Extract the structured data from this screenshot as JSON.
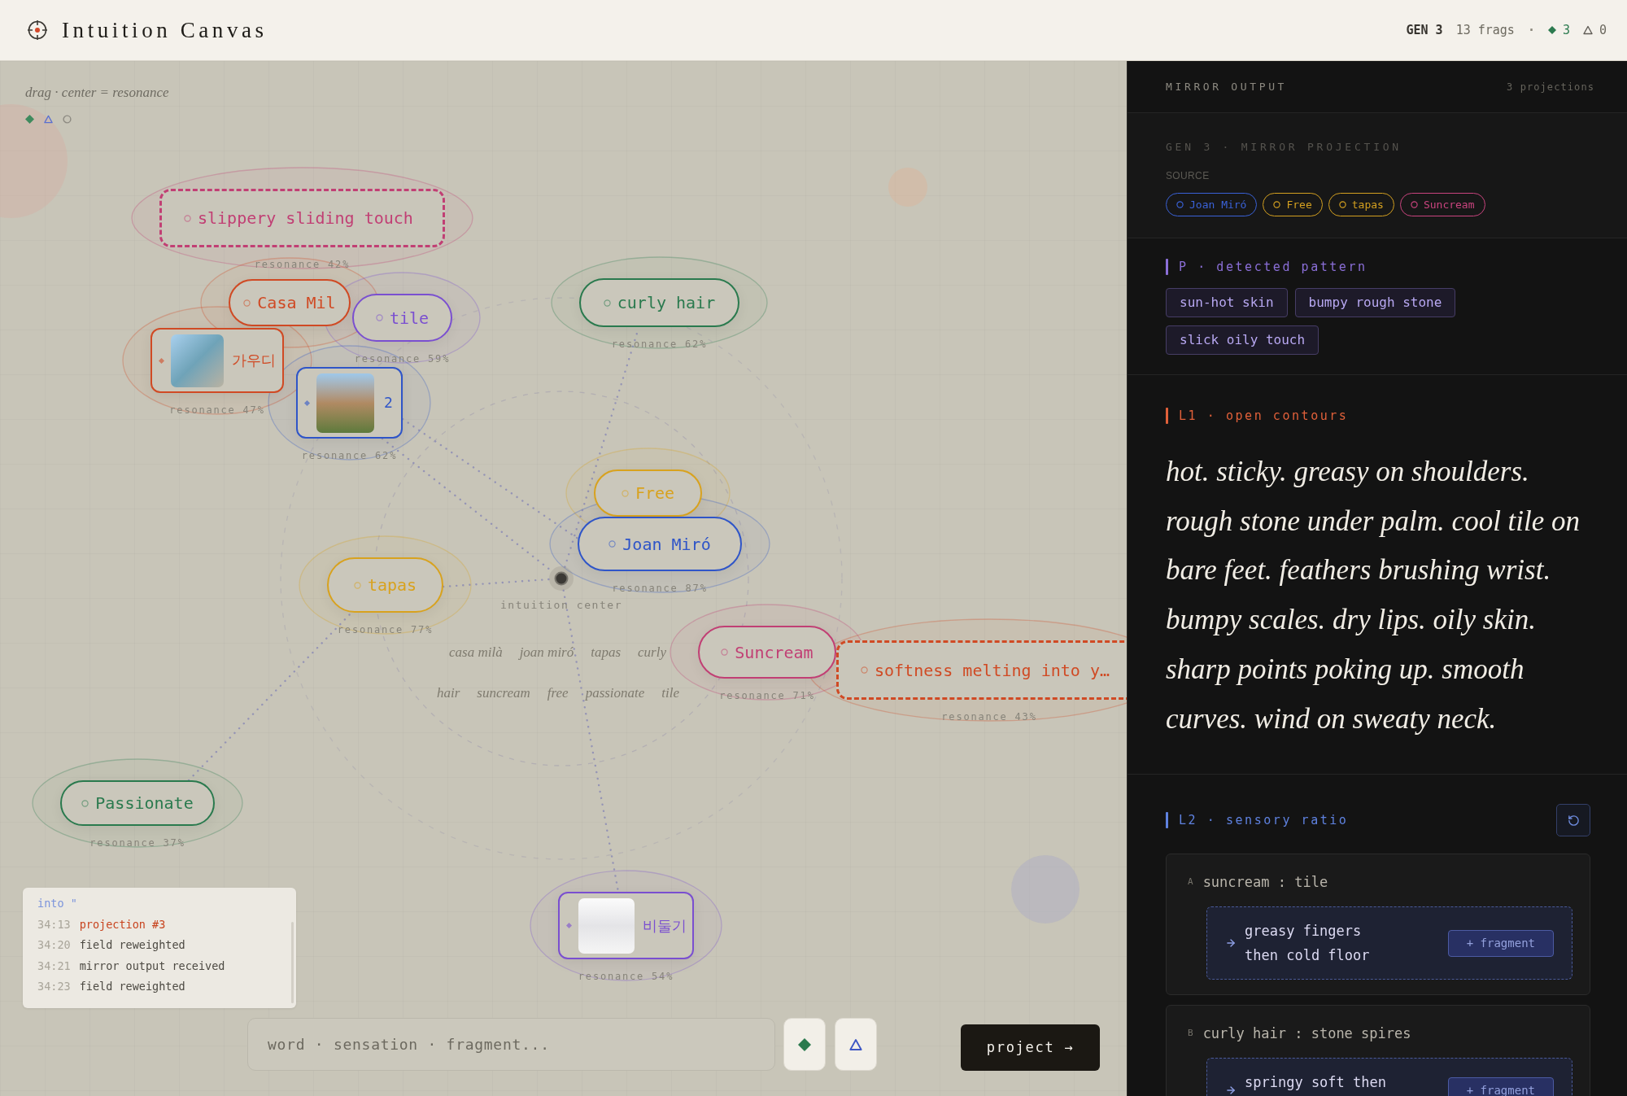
{
  "header": {
    "title": "Intuition Canvas",
    "stats": [
      {
        "kind": "generation",
        "text": "GEN 3"
      },
      {
        "kind": "fragments",
        "text": "13 frags"
      },
      {
        "kind": "separator",
        "text": "·"
      },
      {
        "kind": "kept",
        "text": "3"
      },
      {
        "kind": "flagged",
        "text": "0"
      }
    ]
  },
  "canvas": {
    "hint": "drag · center = resonance",
    "legend": [
      {
        "kind": "diamond",
        "color": "#3f8a5e"
      },
      {
        "kind": "triangle",
        "color": "#5a6fd0"
      },
      {
        "kind": "circle",
        "color": "#8d8a82"
      }
    ],
    "nodes": [
      {
        "kind": "dashed",
        "label": "slippery sliding touch",
        "color": "#c13f74",
        "resonance": "resonance 42%"
      },
      {
        "kind": "pill",
        "label": "Casa Mil",
        "color": "#d04a24"
      },
      {
        "kind": "pill",
        "label": "tile",
        "color": "#7a4fd0",
        "resonance": "resonance 59%"
      },
      {
        "kind": "pill",
        "label": "curly hair",
        "color": "#2a7a4e",
        "resonance": "resonance 62%"
      },
      {
        "kind": "image",
        "label": "가우디",
        "color": "#d04a24",
        "resonance": "resonance 47%"
      },
      {
        "kind": "image",
        "label": "2",
        "color": "#2f55c8",
        "resonance": "resonance 62%"
      },
      {
        "kind": "pill",
        "label": "Free",
        "color": "#d8a21e"
      },
      {
        "kind": "pill",
        "label": "Joan Miró",
        "color": "#2f55c8",
        "resonance": "resonance 87%"
      },
      {
        "kind": "pill",
        "label": "tapas",
        "color": "#d8a21e",
        "resonance": "resonance 77%"
      },
      {
        "kind": "pill",
        "label": "Suncream",
        "color": "#c13f74",
        "resonance": "resonance 71%"
      },
      {
        "kind": "dashed",
        "label": "softness melting into y…",
        "color": "#d04a24",
        "resonance": "resonance 43%"
      },
      {
        "kind": "pill",
        "label": "Passionate",
        "color": "#2a7a4e",
        "resonance": "resonance 37%"
      },
      {
        "kind": "image",
        "label": "비둘기",
        "color": "#7a4fd0",
        "resonance": "resonance 54%"
      }
    ],
    "center_label": "intuition center",
    "word_rows": [
      {
        "words": [
          "casa milà",
          "joan miró",
          "tapas",
          "curly"
        ]
      },
      {
        "words": [
          "hair",
          "suncream",
          "free",
          "passionate",
          "tile"
        ]
      }
    ],
    "log": [
      {
        "kind": "fragment",
        "text": "into \""
      },
      {
        "kind": "projection",
        "time": "34:13",
        "text": "projection #3"
      },
      {
        "kind": "event",
        "time": "34:20",
        "text": "field reweighted"
      },
      {
        "kind": "event",
        "time": "34:21",
        "text": "mirror output received"
      },
      {
        "kind": "event",
        "time": "34:23",
        "text": "field reweighted"
      }
    ],
    "input": {
      "placeholder": "word · sensation · fragment..."
    },
    "tools": [
      {
        "kind": "diamond"
      },
      {
        "kind": "triangle"
      }
    ],
    "project_button": "project →"
  },
  "mirror": {
    "title": "MIRROR OUTPUT",
    "count": "3 projections",
    "projection": {
      "heading": "GEN 3 · MIRROR PROJECTION",
      "source_label": "SOURCE",
      "sources": [
        {
          "label": "Joan Miró",
          "color": "#3a62d8"
        },
        {
          "label": "Free",
          "color": "#d4a020"
        },
        {
          "label": "tapas",
          "color": "#d4a020"
        },
        {
          "label": "Suncream",
          "color": "#c9447e"
        }
      ]
    },
    "sections": [
      {
        "kind": "tags",
        "heading": "P · detected pattern",
        "color": "#8b6fd8",
        "tags": [
          "sun-hot skin",
          "bumpy rough stone",
          "slick oily touch"
        ]
      },
      {
        "kind": "prose",
        "heading": "L1 · open contours",
        "color": "#e0603a",
        "lines": [
          "hot. sticky. greasy on shoulders.",
          "rough stone under palm. cool tile on",
          "bare feet. feathers brushing wrist.",
          "bumpy scales. dry lips. oily skin.",
          "sharp points poking up. smooth",
          "curves. wind on sweaty neck."
        ]
      },
      {
        "kind": "pairs",
        "heading": "L2 · sensory ratio",
        "color": "#5f82e0",
        "pairs": [
          {
            "letter": "A",
            "pair": "suncream : tile",
            "fragment": "greasy fingers then cold floor",
            "action": "+ fragment"
          },
          {
            "letter": "B",
            "pair": "curly hair : stone spires",
            "fragment": "springy soft then",
            "action": "+ fragment"
          }
        ]
      }
    ]
  }
}
